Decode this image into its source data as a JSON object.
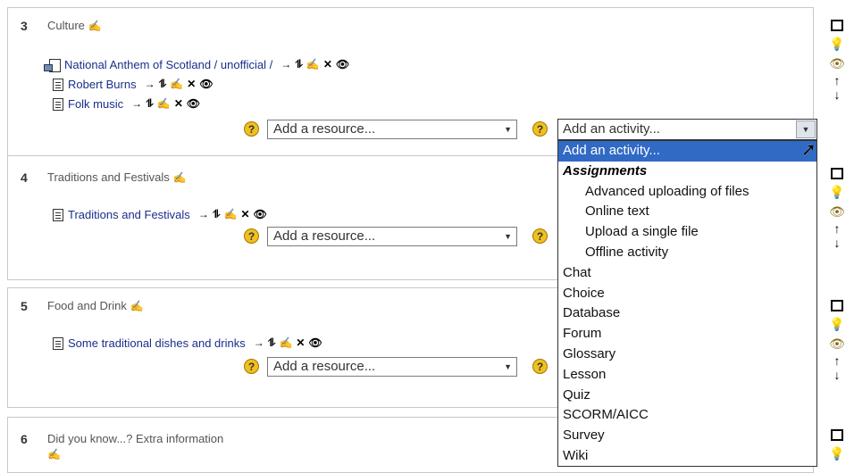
{
  "sections": [
    {
      "number": "3",
      "title": "Culture",
      "resources": [
        {
          "label": "National Anthem of Scotland / unofficial /",
          "icon": "media-file-icon"
        },
        {
          "label": "Robert Burns",
          "icon": "document-icon"
        },
        {
          "label": "Folk music",
          "icon": "document-icon"
        }
      ],
      "add_resource": "Add a resource...",
      "add_activity": "Add an activity..."
    },
    {
      "number": "4",
      "title": "Traditions and Festivals",
      "resources": [
        {
          "label": "Traditions and Festivals",
          "icon": "document-icon"
        }
      ],
      "add_resource": "Add a resource..."
    },
    {
      "number": "5",
      "title": "Food and Drink",
      "resources": [
        {
          "label": "Some traditional dishes and drinks",
          "icon": "document-icon"
        }
      ],
      "add_resource": "Add a resource..."
    },
    {
      "number": "6",
      "title": "Did you know...? Extra information",
      "resources": []
    }
  ],
  "help_symbol": "?",
  "resource_tools": {
    "move": "→",
    "indent": "⥮",
    "edit": "✍",
    "delete": "✕",
    "visibility": "👁"
  },
  "side_tools": {
    "highlight": "",
    "marker": "💡",
    "show": "👁",
    "up": "↑",
    "down": "↓"
  },
  "activity_dropdown": {
    "options": [
      {
        "label": "Add an activity...",
        "kind": "selected"
      },
      {
        "label": "Assignments",
        "kind": "group"
      },
      {
        "label": "Advanced uploading of files",
        "kind": "indent"
      },
      {
        "label": "Online text",
        "kind": "indent"
      },
      {
        "label": "Upload a single file",
        "kind": "indent"
      },
      {
        "label": "Offline activity",
        "kind": "indent"
      },
      {
        "label": "Chat",
        "kind": "item"
      },
      {
        "label": "Choice",
        "kind": "item"
      },
      {
        "label": "Database",
        "kind": "item"
      },
      {
        "label": "Forum",
        "kind": "item"
      },
      {
        "label": "Glossary",
        "kind": "item"
      },
      {
        "label": "Lesson",
        "kind": "item"
      },
      {
        "label": "Quiz",
        "kind": "item"
      },
      {
        "label": "SCORM/AICC",
        "kind": "item"
      },
      {
        "label": "Survey",
        "kind": "item"
      },
      {
        "label": "Wiki",
        "kind": "item"
      }
    ]
  },
  "colors": {
    "link": "#1a2f8a",
    "highlight": "#316ac5",
    "help_icon": "#f0c020"
  }
}
